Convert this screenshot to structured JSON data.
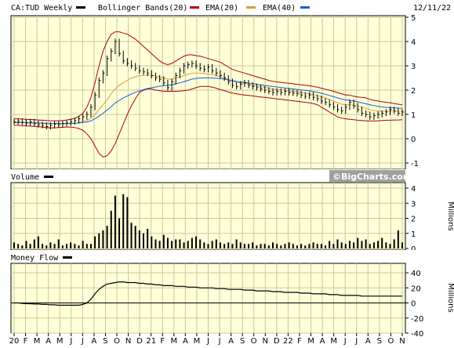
{
  "header": {
    "symbol_label": "CA:TUD Weekly",
    "legend": [
      {
        "label": "Bollinger Bands(20)",
        "color": "#000000"
      },
      {
        "label": "EMA(20)",
        "color": "#b00000"
      },
      {
        "label": "EMA(40)",
        "color": "#d8a040"
      },
      {
        "label": "",
        "color": "#1060e0"
      }
    ],
    "date": "12/11/22"
  },
  "volume_panel": {
    "label": "Volume",
    "units": "Millions"
  },
  "moneyflow_panel": {
    "label": "Money Flow",
    "units": "Millions"
  },
  "watermark": "©BigCharts.com",
  "colors": {
    "plot_bg": "#ffffd8",
    "grid": "#c8c8a0",
    "price": "#000000",
    "bb_band": "#b00000",
    "ema20": "#d8a040",
    "ema40": "#1060e0",
    "watermark_bg": "#a0a0a0"
  },
  "chart_data": {
    "type": "line",
    "x_labels": [
      "20",
      "F",
      "M",
      "A",
      "M",
      "J",
      "J",
      "A",
      "S",
      "O",
      "N",
      "D",
      "21",
      "F",
      "M",
      "A",
      "M",
      "J",
      "J",
      "A",
      "S",
      "O",
      "N",
      "D",
      "22",
      "F",
      "M",
      "A",
      "M",
      "J",
      "J",
      "A",
      "S",
      "O",
      "N"
    ],
    "price": {
      "ylim": [
        -1,
        5
      ],
      "yticks": [
        -1,
        0,
        1,
        2,
        3,
        4,
        5
      ],
      "close": [
        0.7,
        0.72,
        0.68,
        0.65,
        0.7,
        0.62,
        0.58,
        0.55,
        0.5,
        0.55,
        0.6,
        0.58,
        0.62,
        0.65,
        0.7,
        0.75,
        0.82,
        0.9,
        1.0,
        1.3,
        1.8,
        2.4,
        2.7,
        3.3,
        3.6,
        4.0,
        3.5,
        3.2,
        3.1,
        3.0,
        2.9,
        2.8,
        2.75,
        2.7,
        2.6,
        2.5,
        2.45,
        2.3,
        2.1,
        2.35,
        2.6,
        2.8,
        3.0,
        3.05,
        3.1,
        3.0,
        2.9,
        2.85,
        2.95,
        2.8,
        2.7,
        2.6,
        2.5,
        2.35,
        2.2,
        2.15,
        2.25,
        2.3,
        2.2,
        2.15,
        2.1,
        2.05,
        2.0,
        1.95,
        1.9,
        1.95,
        1.9,
        1.95,
        1.9,
        1.88,
        1.85,
        1.8,
        1.75,
        1.8,
        1.7,
        1.65,
        1.55,
        1.5,
        1.4,
        1.3,
        1.2,
        1.15,
        1.3,
        1.5,
        1.35,
        1.2,
        1.05,
        1.0,
        0.9,
        0.95,
        1.0,
        1.05,
        1.1,
        1.2,
        1.15,
        1.05,
        1.1
      ],
      "ema20": [
        0.68,
        0.68,
        0.67,
        0.67,
        0.66,
        0.66,
        0.65,
        0.64,
        0.63,
        0.62,
        0.62,
        0.62,
        0.62,
        0.62,
        0.63,
        0.64,
        0.67,
        0.7,
        0.75,
        0.85,
        1.0,
        1.2,
        1.4,
        1.6,
        1.85,
        2.05,
        2.2,
        2.3,
        2.4,
        2.5,
        2.55,
        2.6,
        2.6,
        2.62,
        2.6,
        2.58,
        2.55,
        2.5,
        2.45,
        2.45,
        2.5,
        2.55,
        2.6,
        2.65,
        2.7,
        2.7,
        2.7,
        2.68,
        2.66,
        2.64,
        2.6,
        2.56,
        2.5,
        2.44,
        2.38,
        2.32,
        2.3,
        2.28,
        2.24,
        2.2,
        2.17,
        2.14,
        2.11,
        2.08,
        2.05,
        2.03,
        2.01,
        1.99,
        1.97,
        1.95,
        1.93,
        1.9,
        1.87,
        1.85,
        1.82,
        1.78,
        1.73,
        1.68,
        1.62,
        1.55,
        1.48,
        1.42,
        1.4,
        1.4,
        1.38,
        1.35,
        1.3,
        1.25,
        1.2,
        1.16,
        1.14,
        1.13,
        1.13,
        1.14,
        1.14,
        1.13,
        1.13
      ],
      "ema40": [
        0.66,
        0.66,
        0.66,
        0.66,
        0.65,
        0.65,
        0.65,
        0.64,
        0.64,
        0.63,
        0.63,
        0.63,
        0.63,
        0.63,
        0.63,
        0.64,
        0.65,
        0.67,
        0.69,
        0.74,
        0.82,
        0.93,
        1.05,
        1.18,
        1.32,
        1.47,
        1.58,
        1.68,
        1.76,
        1.84,
        1.91,
        1.97,
        2.02,
        2.07,
        2.1,
        2.13,
        2.16,
        2.18,
        2.2,
        2.22,
        2.26,
        2.3,
        2.35,
        2.4,
        2.45,
        2.48,
        2.5,
        2.5,
        2.51,
        2.5,
        2.49,
        2.47,
        2.45,
        2.42,
        2.39,
        2.36,
        2.34,
        2.32,
        2.29,
        2.27,
        2.24,
        2.22,
        2.19,
        2.17,
        2.15,
        2.13,
        2.11,
        2.09,
        2.07,
        2.05,
        2.03,
        2.01,
        1.99,
        1.97,
        1.94,
        1.91,
        1.87,
        1.83,
        1.78,
        1.73,
        1.68,
        1.63,
        1.6,
        1.58,
        1.55,
        1.52,
        1.48,
        1.44,
        1.4,
        1.36,
        1.33,
        1.31,
        1.29,
        1.28,
        1.27,
        1.26,
        1.25
      ],
      "bb_upper": [
        0.82,
        0.82,
        0.81,
        0.8,
        0.79,
        0.78,
        0.77,
        0.76,
        0.75,
        0.74,
        0.74,
        0.74,
        0.75,
        0.77,
        0.8,
        0.84,
        0.92,
        1.05,
        1.3,
        1.7,
        2.3,
        3.0,
        3.6,
        4.0,
        4.3,
        4.4,
        4.4,
        4.35,
        4.3,
        4.2,
        4.1,
        3.95,
        3.8,
        3.65,
        3.5,
        3.35,
        3.2,
        3.1,
        3.05,
        3.1,
        3.2,
        3.3,
        3.4,
        3.45,
        3.45,
        3.42,
        3.4,
        3.35,
        3.3,
        3.25,
        3.2,
        3.15,
        3.05,
        2.95,
        2.85,
        2.8,
        2.75,
        2.7,
        2.65,
        2.6,
        2.55,
        2.5,
        2.45,
        2.4,
        2.36,
        2.34,
        2.32,
        2.3,
        2.28,
        2.26,
        2.24,
        2.22,
        2.2,
        2.18,
        2.15,
        2.12,
        2.08,
        2.04,
        2.0,
        1.95,
        1.9,
        1.85,
        1.8,
        1.8,
        1.75,
        1.72,
        1.7,
        1.68,
        1.62,
        1.58,
        1.55,
        1.52,
        1.5,
        1.48,
        1.45,
        1.42,
        1.4
      ],
      "bb_lower": [
        0.55,
        0.55,
        0.54,
        0.53,
        0.52,
        0.51,
        0.5,
        0.48,
        0.46,
        0.45,
        0.45,
        0.46,
        0.47,
        0.48,
        0.48,
        0.46,
        0.42,
        0.35,
        0.2,
        0.0,
        -0.3,
        -0.6,
        -0.75,
        -0.7,
        -0.5,
        -0.2,
        0.2,
        0.6,
        1.0,
        1.35,
        1.65,
        1.9,
        2.0,
        2.05,
        2.05,
        2.0,
        1.98,
        1.95,
        1.95,
        1.95,
        1.95,
        1.96,
        1.98,
        2.0,
        2.05,
        2.1,
        2.15,
        2.15,
        2.15,
        2.12,
        2.08,
        2.02,
        1.98,
        1.92,
        1.88,
        1.85,
        1.82,
        1.8,
        1.78,
        1.76,
        1.74,
        1.72,
        1.7,
        1.68,
        1.66,
        1.64,
        1.62,
        1.6,
        1.58,
        1.56,
        1.54,
        1.52,
        1.5,
        1.48,
        1.45,
        1.4,
        1.3,
        1.2,
        1.1,
        1.0,
        0.9,
        0.85,
        0.82,
        0.8,
        0.78,
        0.76,
        0.75,
        0.74,
        0.73,
        0.73,
        0.74,
        0.75,
        0.76,
        0.76,
        0.77,
        0.77,
        0.78
      ]
    },
    "volume": {
      "ylim": [
        0,
        4
      ],
      "yticks": [
        0,
        1,
        2,
        3,
        4
      ],
      "values": [
        0.4,
        0.3,
        0.2,
        0.5,
        0.3,
        0.6,
        0.8,
        0.3,
        0.2,
        0.4,
        0.3,
        0.6,
        0.2,
        0.3,
        0.4,
        0.3,
        0.2,
        0.5,
        0.3,
        0.3,
        0.8,
        1.0,
        1.2,
        1.5,
        2.5,
        3.5,
        2.0,
        3.6,
        3.4,
        1.7,
        1.5,
        1.2,
        1.0,
        1.3,
        0.8,
        0.6,
        0.5,
        0.9,
        0.7,
        0.5,
        0.6,
        0.6,
        0.4,
        0.5,
        0.7,
        0.8,
        0.6,
        0.4,
        0.3,
        0.5,
        0.6,
        0.4,
        0.3,
        0.4,
        0.3,
        0.6,
        0.4,
        0.3,
        0.3,
        0.4,
        0.2,
        0.3,
        0.3,
        0.2,
        0.4,
        0.3,
        0.2,
        0.3,
        0.4,
        0.3,
        0.2,
        0.3,
        0.2,
        0.3,
        0.4,
        0.3,
        0.3,
        0.2,
        0.5,
        0.3,
        0.6,
        0.4,
        0.3,
        0.5,
        0.4,
        0.7,
        0.5,
        0.6,
        0.3,
        0.4,
        0.5,
        0.7,
        0.4,
        0.3,
        0.6,
        1.2,
        0.4
      ]
    },
    "money_flow": {
      "ylim": [
        -40,
        40
      ],
      "yticks": [
        -40,
        -20,
        0,
        20,
        40
      ],
      "values": [
        0,
        0,
        -0.5,
        -1,
        -1,
        -1.5,
        -1.5,
        -2,
        -2,
        -2.5,
        -2.5,
        -3,
        -3,
        -3,
        -3,
        -3,
        -3,
        -2,
        0,
        5,
        12,
        18,
        22,
        25,
        26,
        27,
        28,
        28,
        27,
        27,
        27,
        26,
        26,
        25,
        25,
        24,
        24,
        23,
        23,
        23,
        22,
        22,
        22,
        21,
        21,
        21,
        20,
        20,
        20,
        20,
        19,
        19,
        19,
        18,
        18,
        18,
        18,
        17,
        17,
        17,
        16,
        16,
        16,
        16,
        15,
        15,
        15,
        14,
        14,
        14,
        14,
        13,
        13,
        13,
        12,
        12,
        12,
        12,
        11,
        11,
        11,
        10,
        10,
        10,
        10,
        10,
        9,
        9,
        9,
        9,
        9,
        9,
        9,
        9,
        9,
        9,
        9
      ]
    }
  }
}
